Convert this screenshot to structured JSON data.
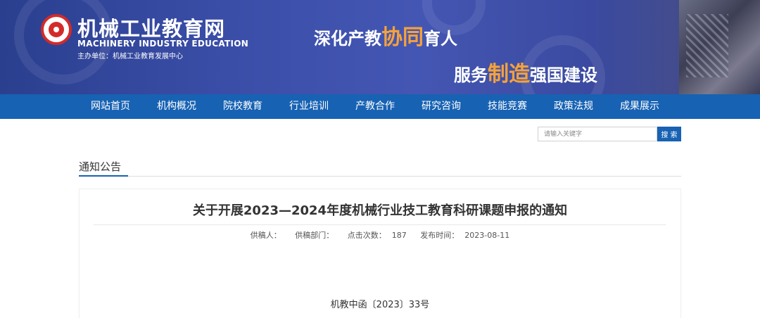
{
  "header": {
    "site_name_cn": "机械工业教育网",
    "site_name_en": "MACHINERY INDUSTRY EDUCATION",
    "sponsor": "主办单位：机械工业教育发展中心",
    "slogan1": {
      "pre": "深化产教",
      "highlight": "协同",
      "post": "育人"
    },
    "slogan2": {
      "pre": "服务",
      "highlight": "制造",
      "post": "强国建设"
    },
    "logo_icon": "gear-logo-icon",
    "colors": {
      "banner": "#3a4ea8",
      "highlight": "#f6a23a"
    }
  },
  "nav": {
    "items": [
      {
        "label": "网站首页"
      },
      {
        "label": "机构概况"
      },
      {
        "label": "院校教育"
      },
      {
        "label": "行业培训"
      },
      {
        "label": "产教合作"
      },
      {
        "label": "研究咨询"
      },
      {
        "label": "技能竞赛"
      },
      {
        "label": "政策法规"
      },
      {
        "label": "成果展示"
      }
    ],
    "color": "#1762b3"
  },
  "search": {
    "placeholder": "请输入关键字",
    "button_label": "搜 索"
  },
  "section": {
    "title": "通知公告"
  },
  "article": {
    "title": "关于开展2023—2024年度机械行业技工教育科研课题申报的通知",
    "meta": {
      "author_label": "供稿人：",
      "department_label": "供稿部门：",
      "clicks_label": "点击次数：",
      "clicks_value": "187",
      "date_label": "发布时间：",
      "date_value": "2023-08-11"
    },
    "doc_number": "机教中函〔2023〕33号"
  }
}
